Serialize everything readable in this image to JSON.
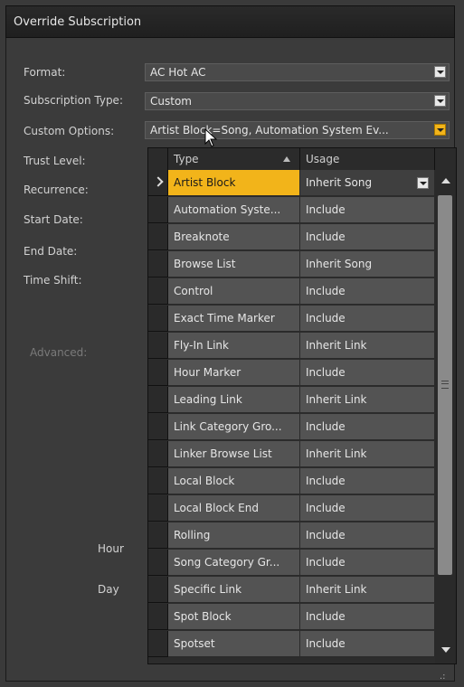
{
  "window": {
    "title": "Override Subscription"
  },
  "form": {
    "format_label": "Format:",
    "format_value": "AC Hot AC",
    "subscription_type_label": "Subscription Type:",
    "subscription_type_value": "Custom",
    "custom_options_label": "Custom Options:",
    "custom_options_value": "Artist Block=Song, Automation System Ev...",
    "trust_level_label": "Trust Level:",
    "recurrence_label": "Recurrence:",
    "start_date_label": "Start Date:",
    "end_date_label": "End Date:",
    "time_shift_label": "Time Shift:",
    "advanced_label": "Advanced:",
    "hour_label": "Hour",
    "day_label": "Day"
  },
  "grid": {
    "columns": [
      "Type",
      "Usage"
    ],
    "rows": [
      {
        "type": "Artist Block",
        "usage": "Inherit Song"
      },
      {
        "type": "Automation Syste...",
        "usage": "Include"
      },
      {
        "type": "Breaknote",
        "usage": "Include"
      },
      {
        "type": "Browse List",
        "usage": "Inherit Song"
      },
      {
        "type": "Control",
        "usage": "Include"
      },
      {
        "type": "Exact Time Marker",
        "usage": "Include"
      },
      {
        "type": "Fly-In Link",
        "usage": "Inherit Link"
      },
      {
        "type": "Hour Marker",
        "usage": "Include"
      },
      {
        "type": "Leading Link",
        "usage": "Inherit Link"
      },
      {
        "type": "Link Category Gro...",
        "usage": "Include"
      },
      {
        "type": "Linker Browse List",
        "usage": "Inherit Link"
      },
      {
        "type": "Local Block",
        "usage": "Include"
      },
      {
        "type": "Local Block End",
        "usage": "Include"
      },
      {
        "type": "Rolling",
        "usage": "Include"
      },
      {
        "type": "Song Category Gr...",
        "usage": "Include"
      },
      {
        "type": "Specific Link",
        "usage": "Inherit Link"
      },
      {
        "type": "Spot Block",
        "usage": "Include"
      },
      {
        "type": "Spotset",
        "usage": "Include"
      }
    ]
  },
  "colors": {
    "accent": "#f2b41a",
    "background": "#3a3a3a"
  }
}
